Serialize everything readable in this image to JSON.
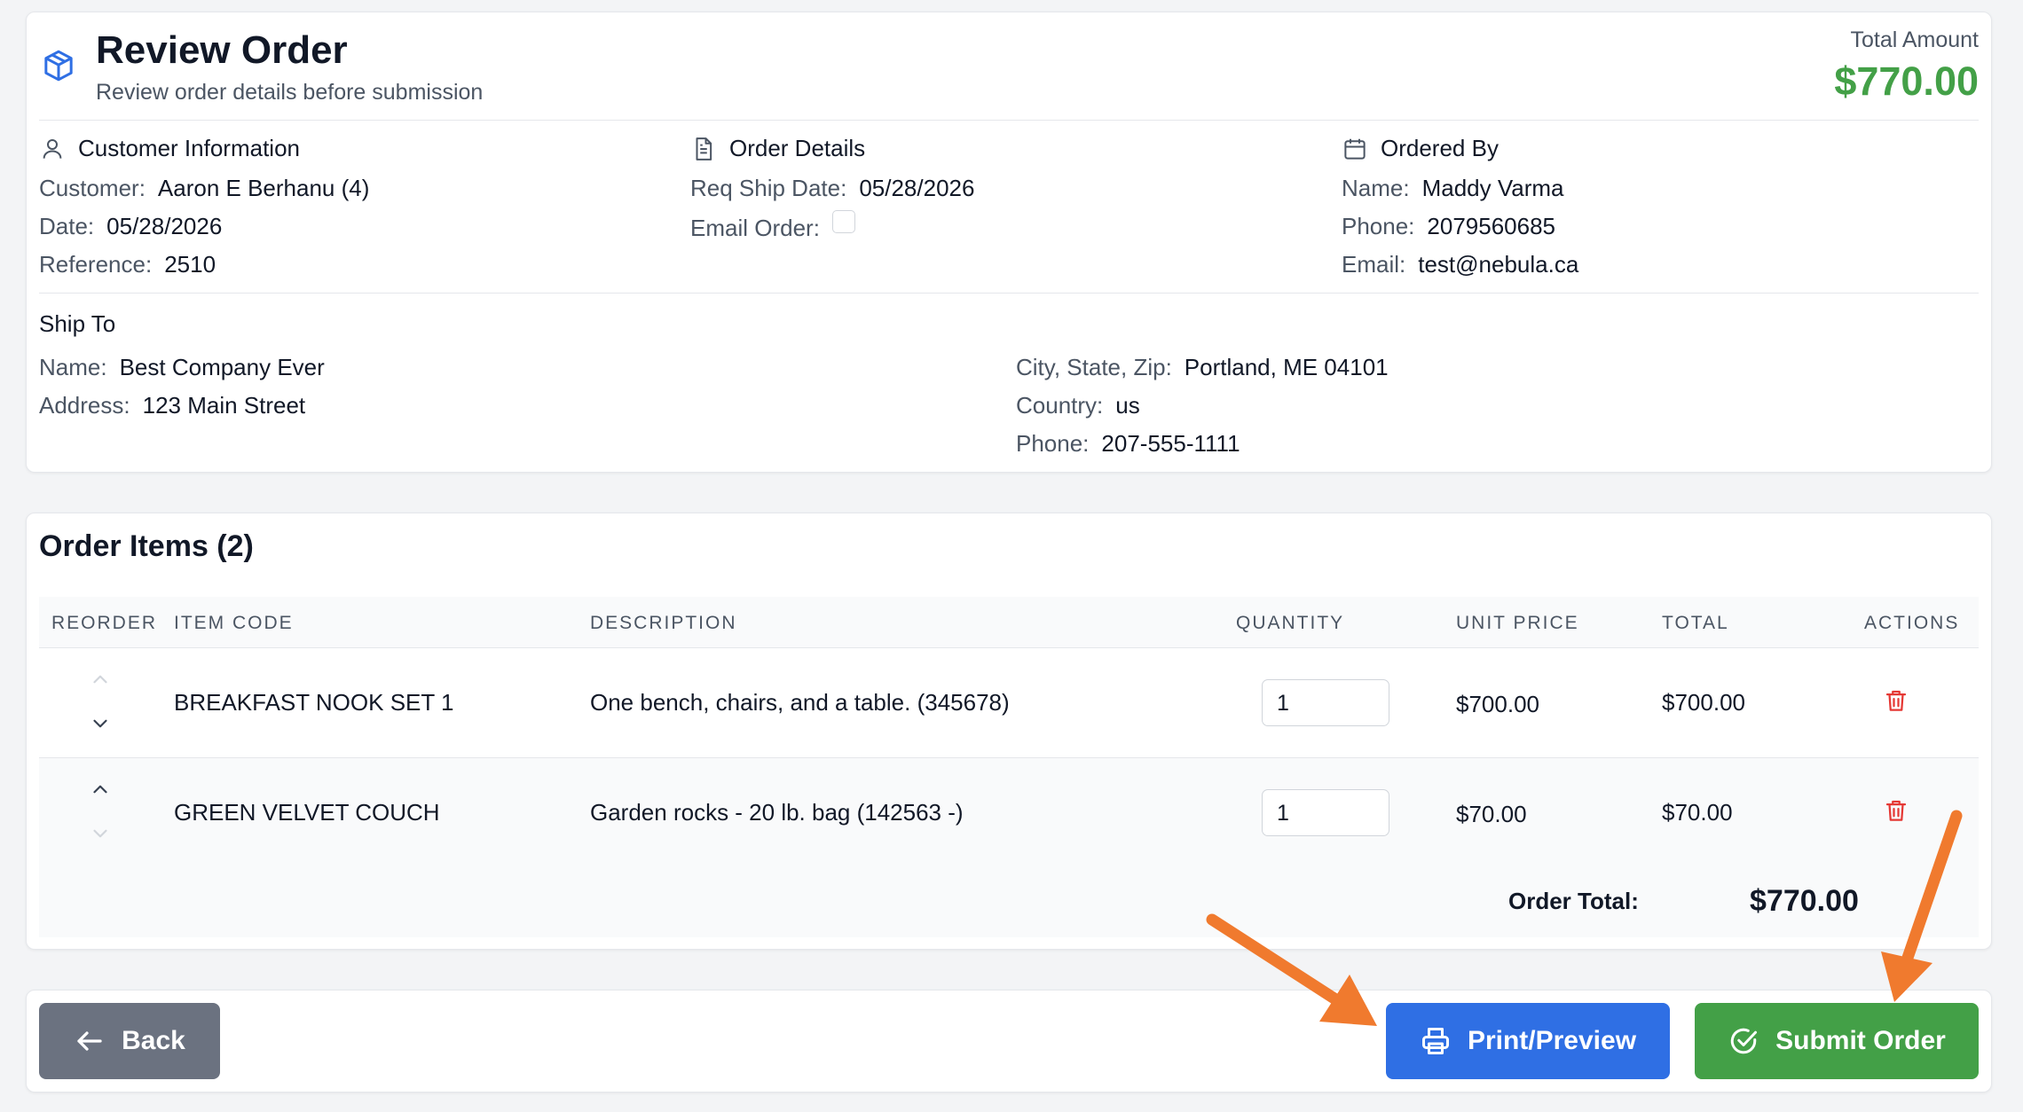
{
  "header": {
    "title": "Review Order",
    "subtitle": "Review order details before submission",
    "total_label": "Total Amount",
    "total_value": "$770.00",
    "icon": "package-icon"
  },
  "customer_info": {
    "heading": "Customer Information",
    "icon": "user-icon",
    "fields": [
      {
        "label": "Customer:",
        "value": "Aaron E Berhanu (4)"
      },
      {
        "label": "Date:",
        "value": "05/28/2026"
      },
      {
        "label": "Reference:",
        "value": "2510"
      }
    ]
  },
  "order_details": {
    "heading": "Order Details",
    "icon": "document-icon",
    "req_ship_label": "Req Ship Date:",
    "req_ship_value": "05/28/2026",
    "email_order_label": "Email Order:",
    "email_order_checked": false
  },
  "ordered_by": {
    "heading": "Ordered By",
    "icon": "calendar-icon",
    "fields": [
      {
        "label": "Name:",
        "value": "Maddy Varma"
      },
      {
        "label": "Phone:",
        "value": "2079560685"
      },
      {
        "label": "Email:",
        "value": "test@nebula.ca"
      }
    ]
  },
  "ship_to": {
    "heading": "Ship To",
    "left": [
      {
        "label": "Name:",
        "value": "Best Company Ever"
      },
      {
        "label": "Address:",
        "value": "123 Main Street"
      }
    ],
    "right": [
      {
        "label": "City, State, Zip:",
        "value": "Portland, ME 04101"
      },
      {
        "label": "Country:",
        "value": "us"
      },
      {
        "label": "Phone:",
        "value": "207-555-1111"
      }
    ]
  },
  "items": {
    "title": "Order Items (2)",
    "columns": [
      "REORDER",
      "ITEM CODE",
      "DESCRIPTION",
      "QUANTITY",
      "UNIT PRICE",
      "TOTAL",
      "ACTIONS"
    ],
    "rows": [
      {
        "item_code": "BREAKFAST NOOK SET 1",
        "description": "One bench, chairs, and a table. (345678)",
        "quantity": "1",
        "unit_price": "$700.00",
        "total": "$700.00"
      },
      {
        "item_code": "GREEN VELVET COUCH",
        "description": "Garden rocks - 20 lb. bag (142563 -)",
        "quantity": "1",
        "unit_price": "$70.00",
        "total": "$70.00"
      }
    ],
    "order_total_label": "Order Total:",
    "order_total_value": "$770.00"
  },
  "footer": {
    "back_label": "Back",
    "print_label": "Print/Preview",
    "submit_label": "Submit Order"
  },
  "colors": {
    "accent_green": "#43a047",
    "accent_blue": "#2f6fe4",
    "neutral_button": "#6b7280",
    "delete_red": "#e53935",
    "annotation_orange": "#f07a2e"
  }
}
